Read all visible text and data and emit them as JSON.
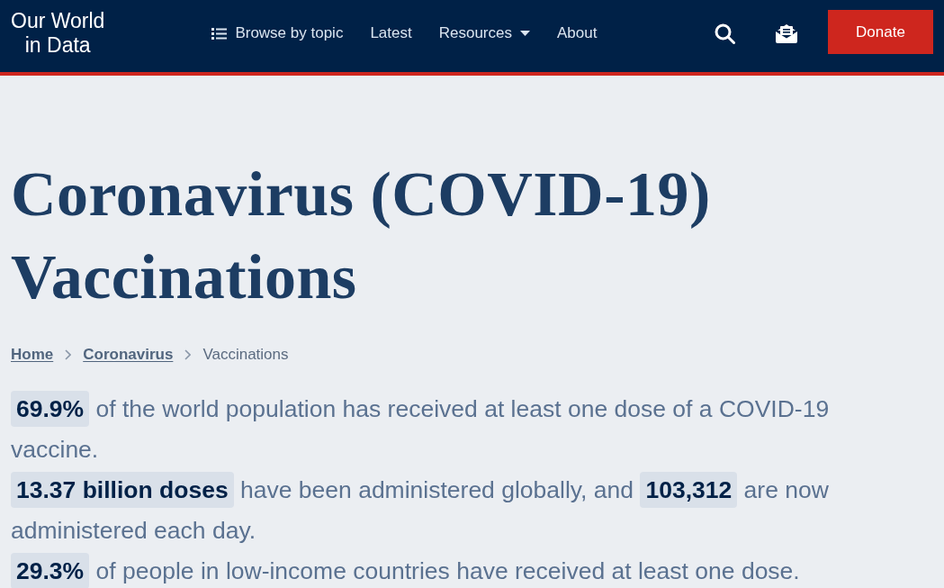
{
  "header": {
    "logo_lines": [
      "Our World",
      "in Data"
    ],
    "nav": [
      {
        "label": "Browse by topic",
        "kind": "topics"
      },
      {
        "label": "Latest",
        "kind": "link"
      },
      {
        "label": "Resources",
        "kind": "dropdown"
      },
      {
        "label": "About",
        "kind": "link"
      }
    ],
    "donate_button": "Donate"
  },
  "title": "Coronavirus (COVID-19) Vaccinations",
  "breadcrumb": [
    {
      "label": "Home",
      "kind": "link"
    },
    {
      "label": "Coronavirus",
      "kind": "link"
    },
    {
      "label": "Vaccinations",
      "kind": "current"
    }
  ],
  "summary": [
    "**69.9%** of the world population has received at least one dose of a COVID-19 vaccine.",
    "**13.37 billion doses** have been administered globally, and **103,312** are now administered each day.",
    "**29.3%** of people in low-income countries have received at least one dose."
  ]
}
